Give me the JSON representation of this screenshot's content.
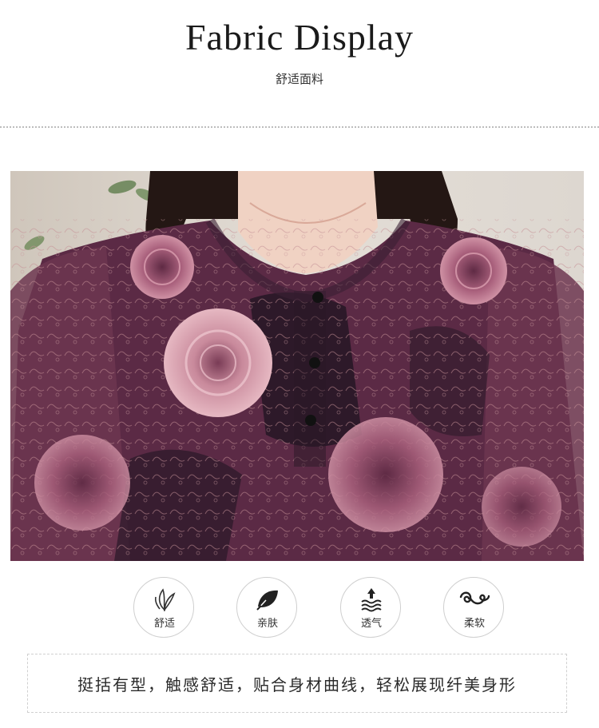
{
  "header": {
    "title": "Fabric  Display",
    "subtitle": "舒适面料"
  },
  "photo": {
    "alt_subject": "floral-blouse-photo"
  },
  "features": [
    {
      "icon": "leaf-icon",
      "label": "舒适"
    },
    {
      "icon": "leaf-dark-icon",
      "label": "亲肤"
    },
    {
      "icon": "breathable-arrow-waves-icon",
      "label": "透气"
    },
    {
      "icon": "soft-swirl-icon",
      "label": "柔软"
    }
  ],
  "description": "挺括有型，触感舒适，贴合身材曲线，轻松展现纤美身形",
  "colors": {
    "fabric_base": "#5b2a45",
    "rose_pink": "#d79aa8",
    "dark_accent": "#1d1420"
  }
}
